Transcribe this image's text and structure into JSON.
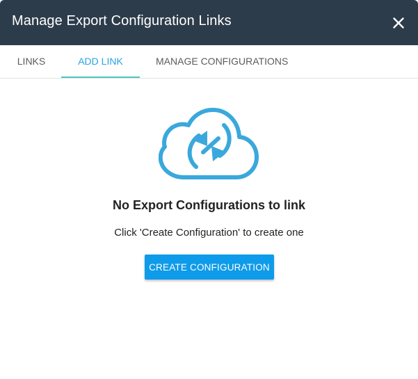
{
  "dialog": {
    "title": "Manage Export Configuration Links",
    "close_icon": "close-icon",
    "header_color": "#2d3c4b"
  },
  "tabs": [
    {
      "label": "LINKS",
      "active": false
    },
    {
      "label": "ADD LINK",
      "active": true
    },
    {
      "label": "MANAGE CONFIGURATIONS",
      "active": false
    }
  ],
  "empty_state": {
    "icon": "cloud-sync-icon",
    "heading": "No Export Configurations to link",
    "message": "Click 'Create Configuration' to create one",
    "button_label": "CREATE CONFIGURATION"
  },
  "colors": {
    "accent": "#0e9bea",
    "active_tab_text": "#2aa3e0",
    "active_tab_underline": "#4cc6c1",
    "icon_blue": "#3aa8dc"
  }
}
